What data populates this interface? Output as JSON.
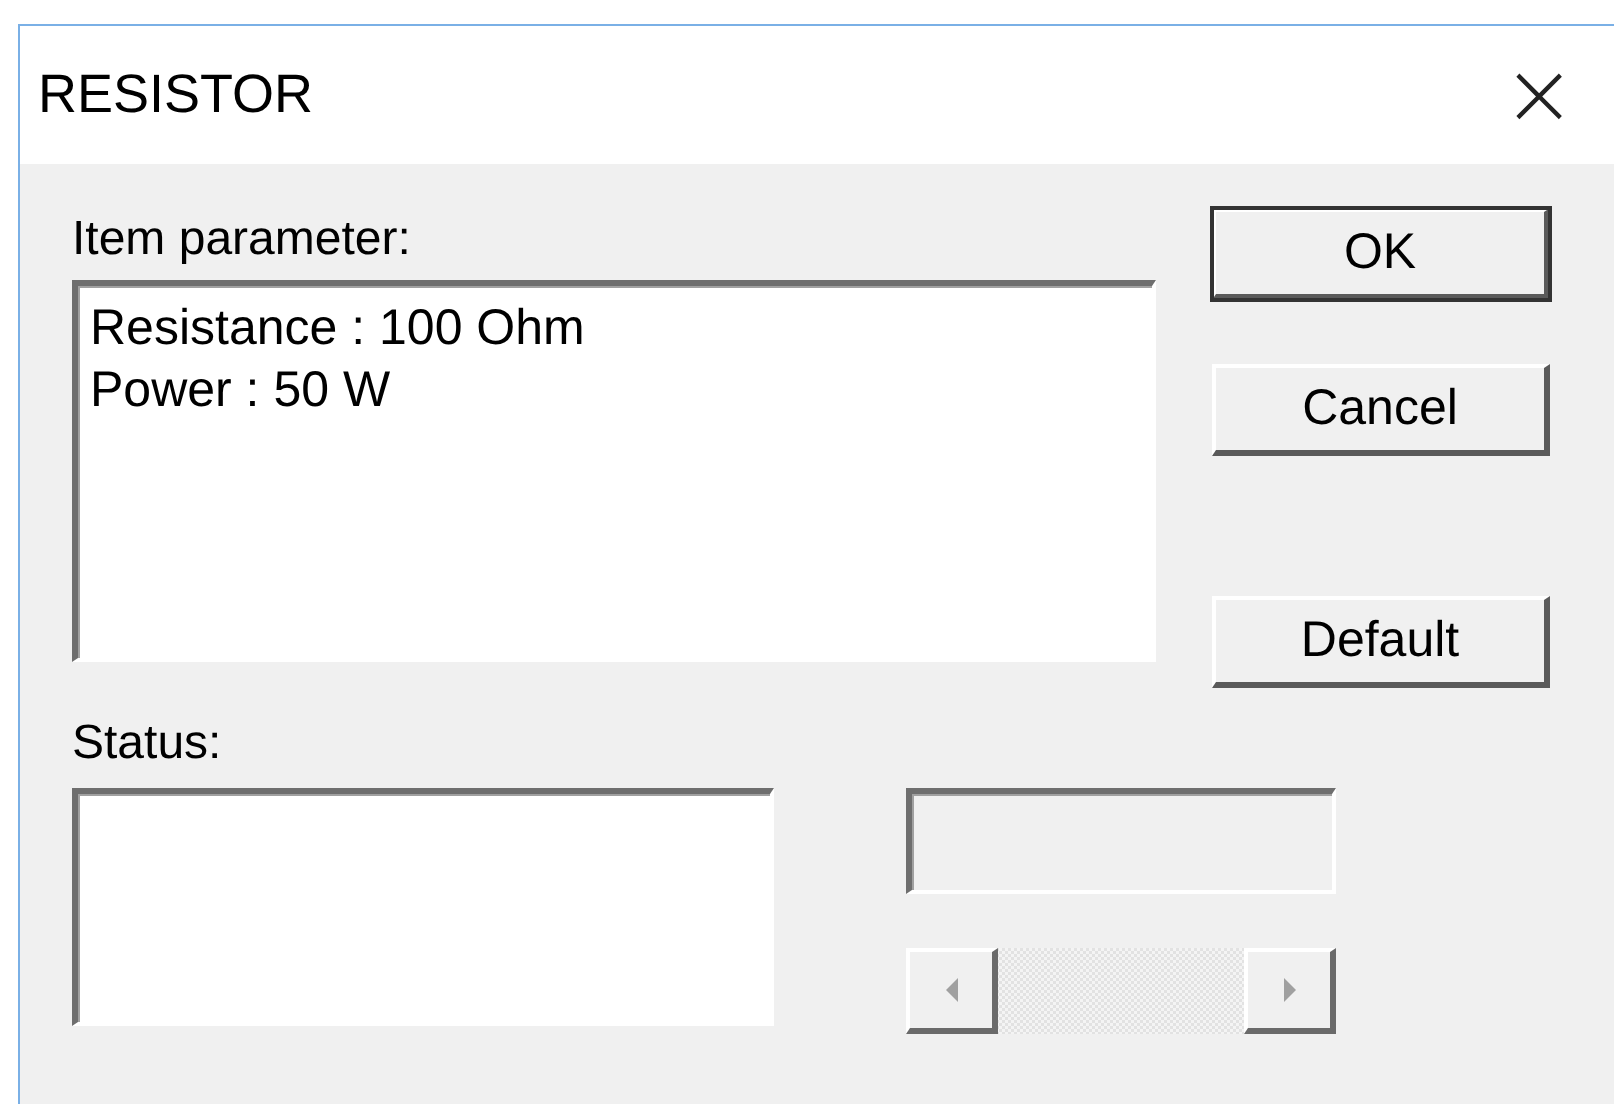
{
  "window": {
    "title": "RESISTOR",
    "close": "×"
  },
  "item_parameter": {
    "label": "Item parameter:",
    "lines": [
      "Resistance : 100 Ohm",
      "Power : 50 W"
    ]
  },
  "buttons": [
    {
      "label": "OK",
      "default": true
    },
    {
      "label": "Cancel",
      "default": false
    },
    {
      "label": "Default",
      "default": false
    }
  ],
  "status": {
    "label": "Status:"
  }
}
